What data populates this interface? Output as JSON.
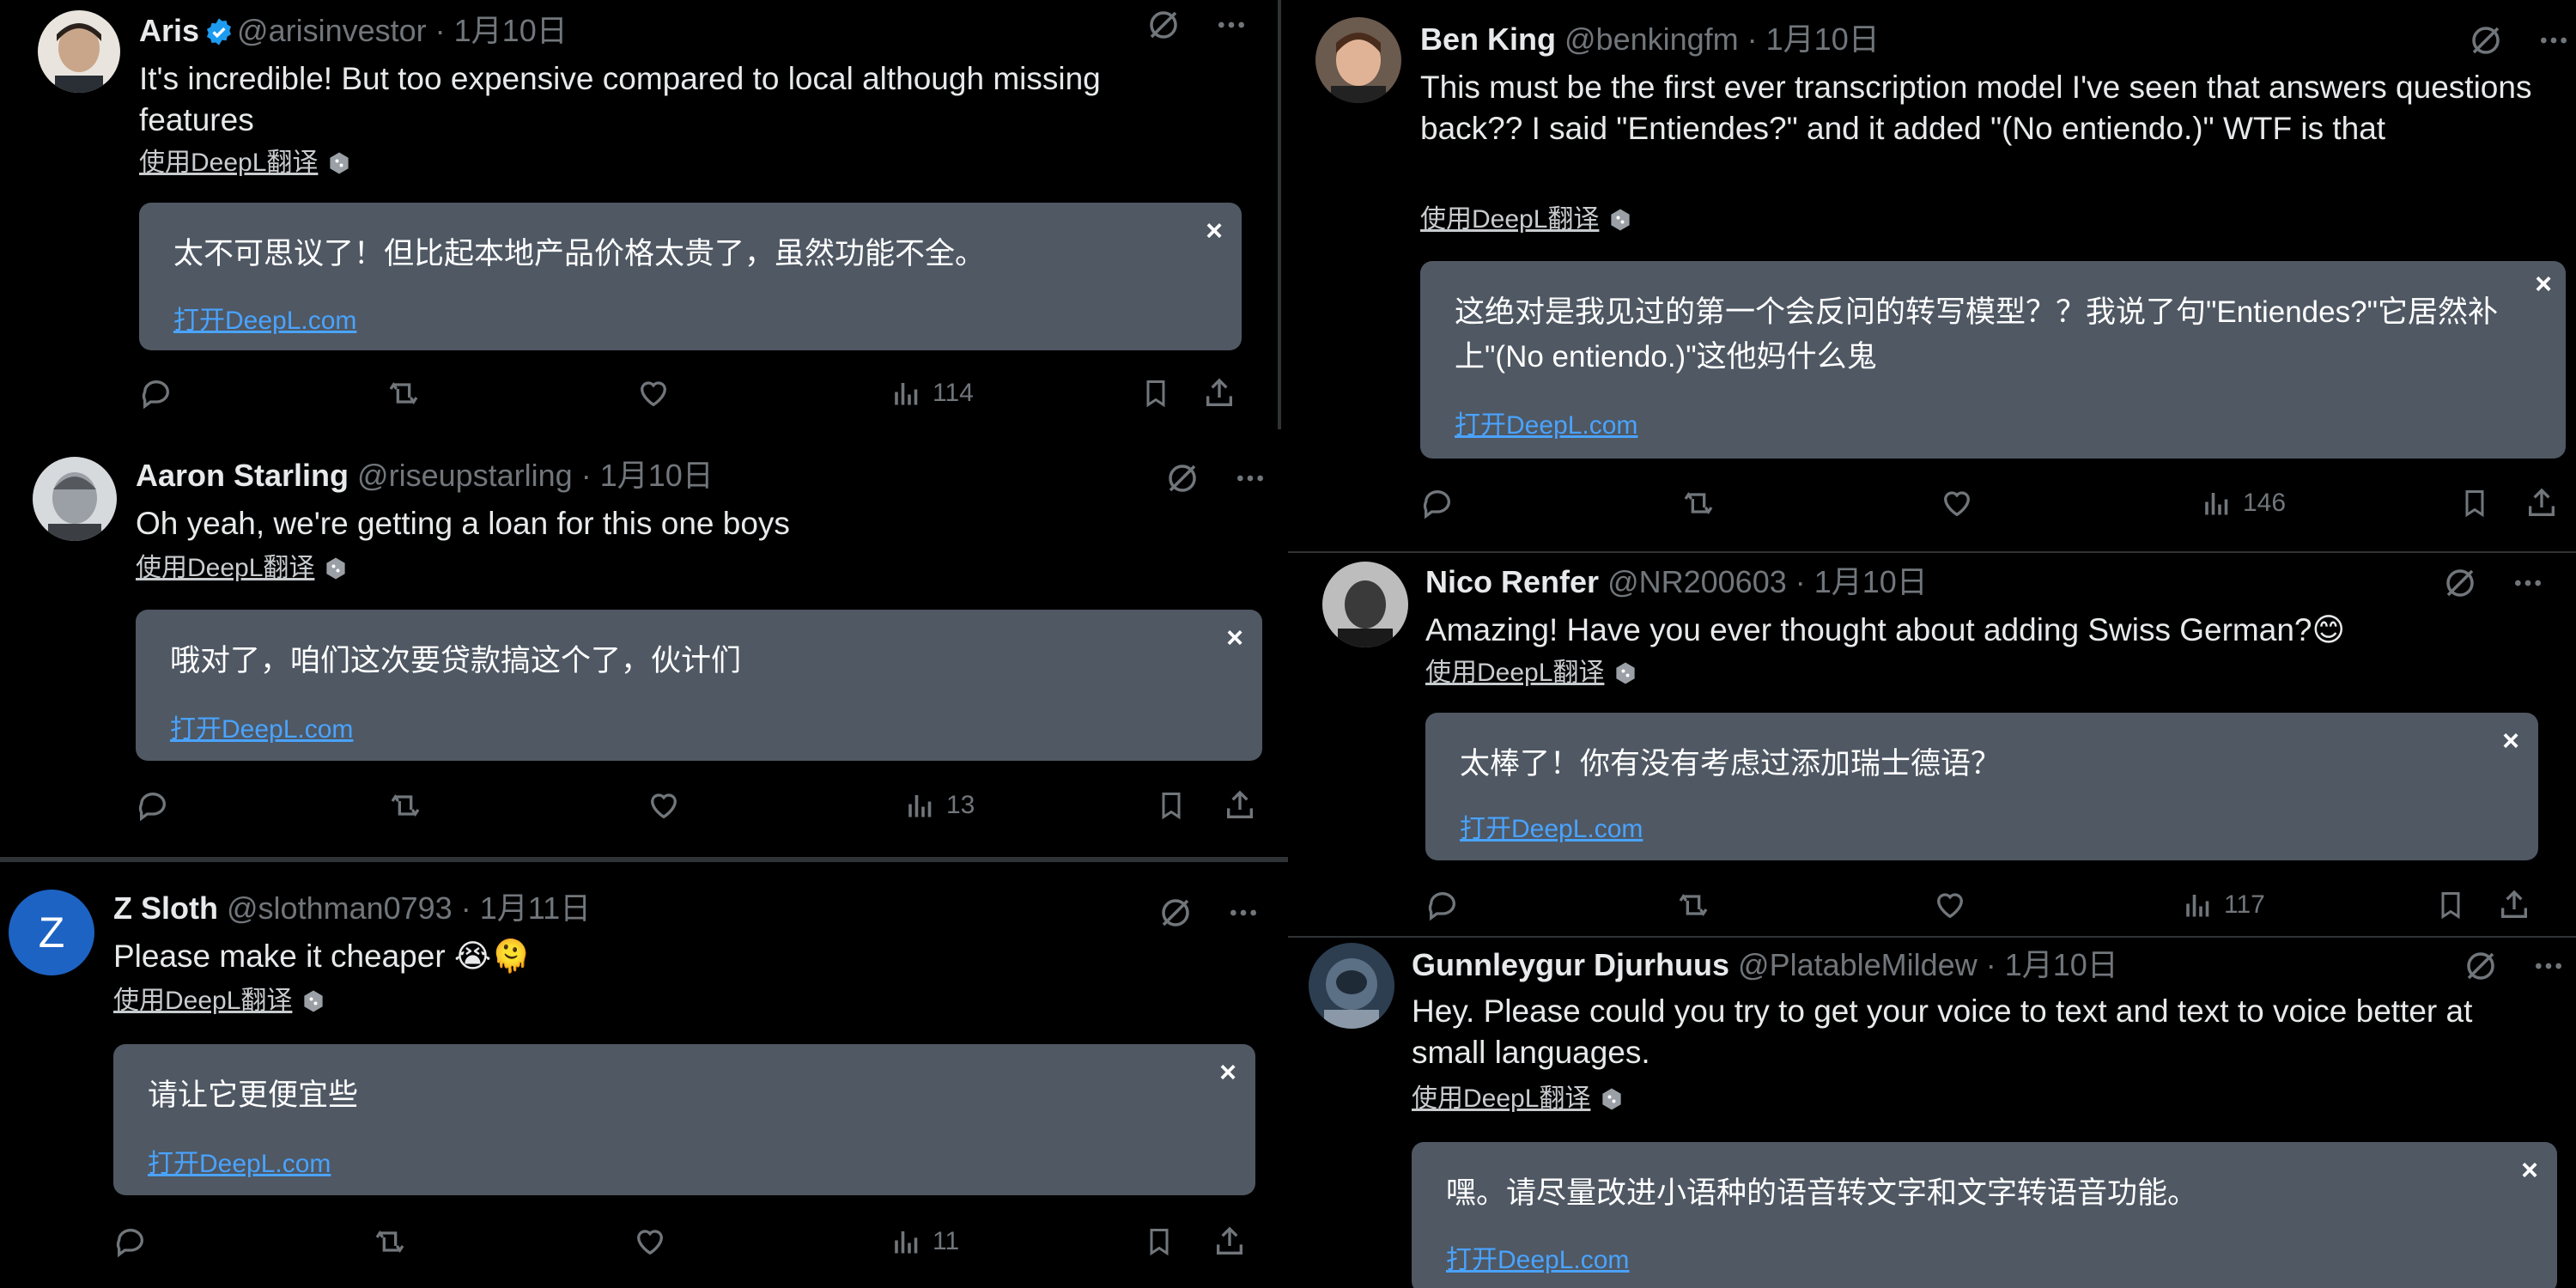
{
  "tweets": [
    {
      "name": "Aris",
      "verified": true,
      "handle": "@arisinvestor",
      "date": "· 1月10日",
      "text": "It's incredible! But too expensive compared to local although missing features",
      "translate_label": "使用DeepL翻译",
      "translation": "太不可思议了！但比起本地产品价格太贵了，虽然功能不全。",
      "open_link": "打开DeepL.com",
      "views": "114",
      "avatar_color": "#c9a68a"
    },
    {
      "name": "Aaron Starling",
      "verified": false,
      "handle": "@riseupstarling",
      "date": "· 1月10日",
      "text": "Oh yeah, we're getting a loan for this one boys",
      "translate_label": "使用DeepL翻译",
      "translation": "哦对了，咱们这次要贷款搞这个了，伙计们",
      "open_link": "打开DeepL.com",
      "views": "13",
      "avatar_color": "#9aa0a6"
    },
    {
      "name": "Z Sloth",
      "verified": false,
      "handle": "@slothman0793",
      "date": "· 1月11日",
      "text": "Please make it cheaper 😭🫠",
      "translate_label": "使用DeepL翻译",
      "translation": "请让它更便宜些",
      "open_link": "打开DeepL.com",
      "views": "11",
      "avatar_letter": "Z",
      "avatar_color": "#1d63c4"
    },
    {
      "name": "Ben King",
      "verified": false,
      "handle": "@benkingfm",
      "date": "· 1月10日",
      "text": "This must be the first ever transcription model I've seen that answers questions back?? I said \"Entiendes?\" and it added \"(No entiendo.)\" WTF is that",
      "translate_label": "使用DeepL翻译",
      "translation": "这绝对是我见过的第一个会反问的转写模型？？我说了句\"Entiendes?\"它居然补上\"(No entiendo.)\"这他妈什么鬼",
      "open_link": "打开DeepL.com",
      "views": "146",
      "avatar_color": "#b8876a"
    },
    {
      "name": "Nico Renfer",
      "verified": false,
      "handle": "@NR200603",
      "date": "· 1月10日",
      "text": "Amazing! Have you ever thought about adding Swiss German?😊",
      "translate_label": "使用DeepL翻译",
      "translation": "太棒了！你有没有考虑过添加瑞士德语？",
      "open_link": "打开DeepL.com",
      "views": "117",
      "avatar_color": "#3a3a3a"
    },
    {
      "name": "Gunnleygur Djurhuus",
      "verified": false,
      "handle": "@PlatableMildew",
      "date": "· 1月10日",
      "text": "Hey. Please could you try to get your voice to text and text to voice better at small languages.",
      "translate_label": "使用DeepL翻译",
      "translation": "嘿。请尽量改进小语种的语音转文字和文字转语音功能。",
      "open_link": "打开DeepL.com",
      "avatar_color": "#5b6f85"
    }
  ],
  "colors": {
    "background": "#000000",
    "muted": "#71767b",
    "translate_box": "#4f5863",
    "link": "#4aa3ff",
    "verified": "#1d9bf0"
  }
}
